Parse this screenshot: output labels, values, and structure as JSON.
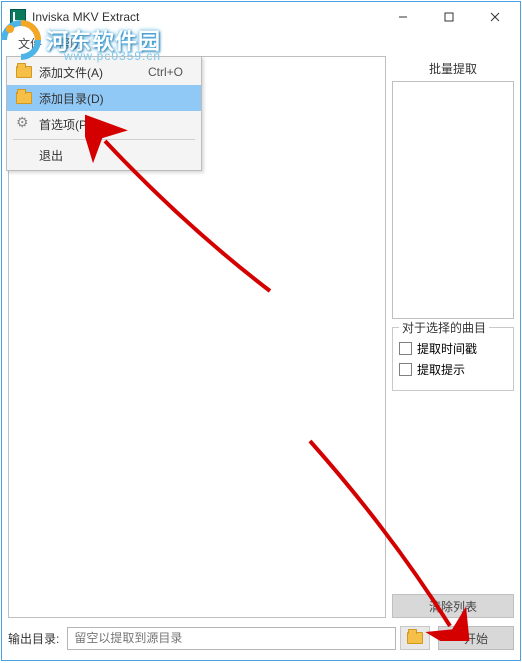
{
  "titlebar": {
    "title": "Inviska MKV Extract"
  },
  "menubar": {
    "file": "文件",
    "help": "帮助"
  },
  "dropdown": {
    "add_file": "添加文件(A)",
    "add_file_shortcut": "Ctrl+O",
    "add_dir": "添加目录(D)",
    "preferences": "首选项(P)",
    "exit": "退出"
  },
  "right": {
    "batch_label": "批量提取",
    "group_label": "对于选择的曲目",
    "chk_timestamps": "提取时间戳",
    "chk_cues": "提取提示",
    "clear_list": "清除列表",
    "start": "开始"
  },
  "bottom": {
    "outdir_label": "输出目录:",
    "placeholder": "留空以提取到源目录"
  },
  "watermark": {
    "text": "河东软件园",
    "url": "www.pc0359.cn"
  }
}
